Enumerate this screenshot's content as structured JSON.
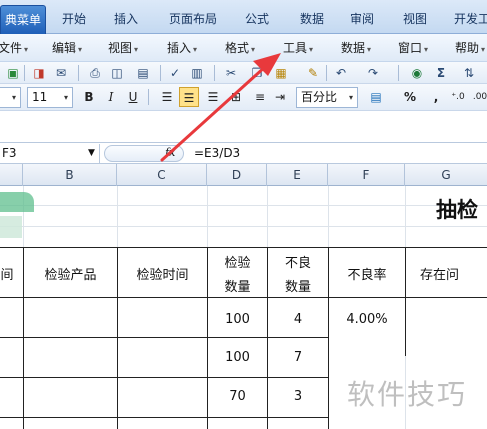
{
  "ribbon": {
    "tabs": [
      {
        "label": "典菜单"
      },
      {
        "label": "开始"
      },
      {
        "label": "插入"
      },
      {
        "label": "页面布局"
      },
      {
        "label": "公式"
      },
      {
        "label": "数据"
      },
      {
        "label": "审阅"
      },
      {
        "label": "视图"
      },
      {
        "label": "开发工"
      }
    ]
  },
  "menubar": {
    "items": [
      {
        "label": "文件"
      },
      {
        "label": "编辑"
      },
      {
        "label": "视图"
      },
      {
        "label": "插入"
      },
      {
        "label": "格式"
      },
      {
        "label": "工具"
      },
      {
        "label": "数据"
      },
      {
        "label": "窗口"
      },
      {
        "label": "帮助"
      }
    ]
  },
  "toolbar": {
    "font_size": "11",
    "bold_label": "B",
    "italic_label": "I",
    "underline_label": "U",
    "number_format": "百分比",
    "percent_label": "%",
    "comma_label": ",",
    "sigma_label": "Σ"
  },
  "formula_bar": {
    "name_box": "F3",
    "fx_label": "fx",
    "formula": "=E3/D3"
  },
  "columns": [
    "B",
    "C",
    "D",
    "E",
    "F",
    "G"
  ],
  "sheet": {
    "title": "抽检",
    "headers": {
      "col_a_tail": "间",
      "product": "检验产品",
      "time": "检验时间",
      "qty_line1": "检验",
      "qty_line2": "数量",
      "bad_line1": "不良",
      "bad_line2": "数量",
      "rate": "不良率",
      "issue": "存在问"
    },
    "rows": [
      {
        "qty": "100",
        "bad": "4",
        "rate": "4.00%"
      },
      {
        "qty": "100",
        "bad": "7",
        "rate": ""
      },
      {
        "qty": "70",
        "bad": "3",
        "rate": ""
      }
    ]
  },
  "watermark": "软件技巧",
  "colors": {
    "annotation_arrow": "#e8393c",
    "active_tab": "#2a6fc9"
  }
}
